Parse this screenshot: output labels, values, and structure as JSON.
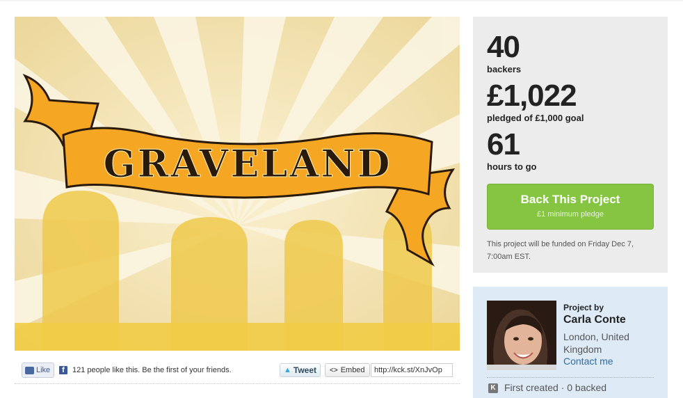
{
  "hero": {
    "title": "GRAVELAND",
    "colors": {
      "sky": "#f3e2ae",
      "rays": "#faf3dc",
      "ribbon": "#f5a623",
      "graves": "#efc84a"
    }
  },
  "social": {
    "like_label": "Like",
    "fb_icon": "f",
    "like_text": "121 people like this. Be the first of your friends.",
    "tweet_label": "Tweet",
    "embed_label": "Embed",
    "short_url": "http://kck.st/XnJvOp"
  },
  "stats": {
    "backers": "40",
    "backers_label": "backers",
    "pledged": "£1,022",
    "pledged_label": "pledged of £1,000 goal",
    "hours": "61",
    "hours_label": "hours to go",
    "back_button": "Back This Project",
    "min_pledge": "£1 minimum pledge",
    "funded_note": "This project will be funded on Friday Dec 7, 7:00am EST."
  },
  "creator": {
    "project_by": "Project by",
    "name": "Carla Conte",
    "location": "London, United Kingdom",
    "contact": "Contact me",
    "badge": "K",
    "history": "First created · 0 backed"
  },
  "colors": {
    "accent_green": "#86c542",
    "panel_gray": "#ececec",
    "panel_blue": "#deebf7",
    "link": "#2f6aa3"
  }
}
